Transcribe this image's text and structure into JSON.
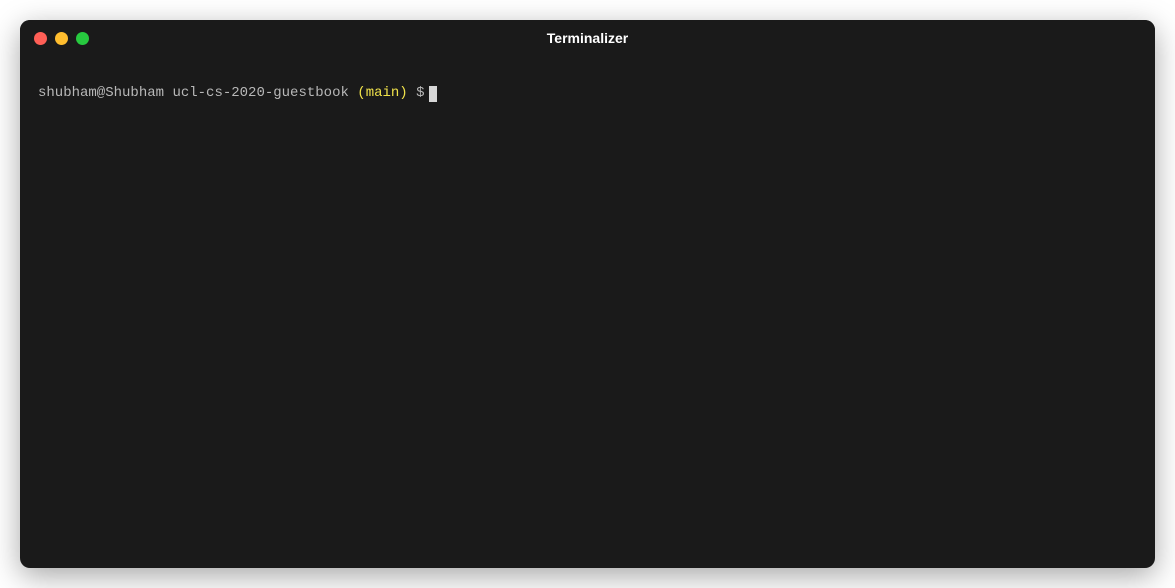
{
  "window": {
    "title": "Terminalizer"
  },
  "prompt": {
    "user_host": "shubham@Shubham",
    "path": "ucl-cs-2020-guestbook",
    "branch_open": "(",
    "branch": "main",
    "branch_close": ")",
    "symbol": "$"
  }
}
